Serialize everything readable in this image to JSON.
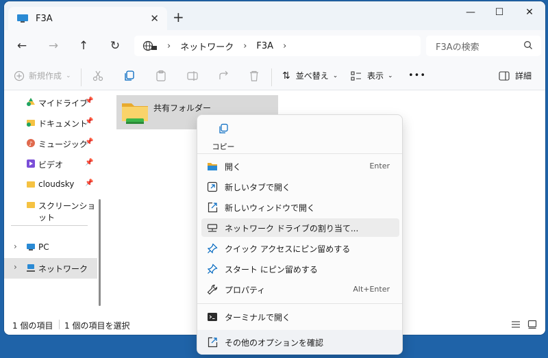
{
  "window": {
    "tab_title": "F3A",
    "tab_close": "✕",
    "new_tab": "+",
    "minimize": "—",
    "maximize": "☐",
    "close": "✕"
  },
  "address": {
    "crumbs": [
      "ネットワーク",
      "F3A"
    ],
    "separator": "›",
    "search_placeholder": "F3Aの検索"
  },
  "toolbar": {
    "new_label": "新規作成",
    "sort_label": "並べ替え",
    "view_label": "表示",
    "more_label": "•••",
    "details_label": "詳細"
  },
  "sidebar": {
    "items": [
      {
        "label": "マイドライブ",
        "pinned": true
      },
      {
        "label": "ドキュメント",
        "pinned": true
      },
      {
        "label": "ミュージック",
        "pinned": true
      },
      {
        "label": "ビデオ",
        "pinned": true
      },
      {
        "label": "cloudsky",
        "pinned": true
      },
      {
        "label": "スクリーンショット",
        "pinned": false
      },
      {
        "label": "PC"
      },
      {
        "label": "ネットワーク"
      }
    ],
    "pin_glyph": "📌",
    "chevron": "›"
  },
  "content": {
    "folder_label": "共有フォルダー"
  },
  "status": {
    "item_count": "1 個の項目",
    "selected_count": "1 個の項目を選択"
  },
  "context_menu": {
    "copy_label": "コピー",
    "items": [
      {
        "label": "開く",
        "shortcut": "Enter"
      },
      {
        "label": "新しいタブで開く"
      },
      {
        "label": "新しいウィンドウで開く"
      },
      {
        "label": "ネットワーク ドライブの割り当て..."
      },
      {
        "label": "クイック アクセスにピン留めする"
      },
      {
        "label": "スタート にピン留めする"
      },
      {
        "label": "プロパティ",
        "shortcut": "Alt+Enter"
      },
      {
        "label": "ターミナルで開く"
      },
      {
        "label": "その他のオプションを確認"
      }
    ]
  },
  "colors": {
    "desktop": "#1f63a8",
    "accent": "#0067c0",
    "folder": "#f5c242"
  }
}
